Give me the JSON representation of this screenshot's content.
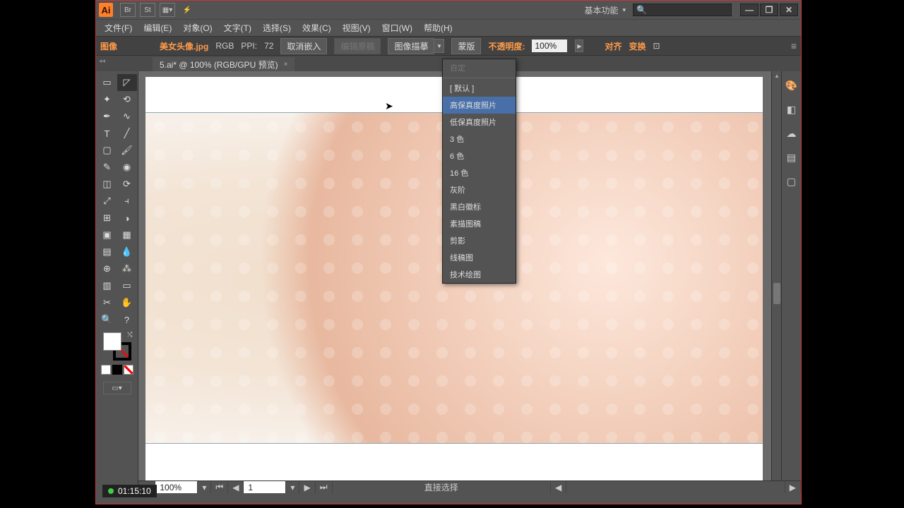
{
  "app": {
    "logo_text": "Ai"
  },
  "titlebar_icons": {
    "br": "Br",
    "st": "St"
  },
  "workspace_label": "基本功能",
  "search_placeholder": "🔍",
  "window_controls": {
    "min": "—",
    "max": "❐",
    "close": "✕"
  },
  "menubar": [
    "文件(F)",
    "编辑(E)",
    "对象(O)",
    "文字(T)",
    "选择(S)",
    "效果(C)",
    "视图(V)",
    "窗口(W)",
    "帮助(H)"
  ],
  "ctrlbar": {
    "label_image": "图像",
    "filename": "美女头像.jpg",
    "colormode": "RGB",
    "ppi_label": "PPI:",
    "ppi_value": "72",
    "btn_unembed": "取消嵌入",
    "btn_editoriginal": "编辑原稿",
    "btn_imagetrace": "图像描摹",
    "btn_mask": "蒙版",
    "opacity_label": "不透明度:",
    "opacity_value": "100%",
    "btn_align": "对齐",
    "btn_transform": "变换",
    "gear": "≡"
  },
  "doc_tab": {
    "title": "5.ai* @ 100% (RGB/GPU 预览)",
    "close": "×"
  },
  "tracing_presets": {
    "header_disabled": "自定",
    "items": [
      "[ 默认 ]",
      "高保真度照片",
      "低保真度照片",
      "3 色",
      "6 色",
      "16 色",
      "灰阶",
      "黑白徽标",
      "素描图稿",
      "剪影",
      "线稿图",
      "技术绘图"
    ],
    "highlighted_index": 1
  },
  "tools": [
    [
      "selection",
      "direct-selection"
    ],
    [
      "magic-wand",
      "lasso"
    ],
    [
      "pen",
      "curvature"
    ],
    [
      "type",
      "line"
    ],
    [
      "rectangle",
      "paintbrush"
    ],
    [
      "pencil",
      "blob-brush"
    ],
    [
      "eraser",
      "rotate"
    ],
    [
      "scale",
      "width"
    ],
    [
      "free-transform",
      "shape-builder"
    ],
    [
      "perspective",
      "mesh"
    ],
    [
      "gradient",
      "eyedropper"
    ],
    [
      "blend",
      "symbol-sprayer"
    ],
    [
      "column-graph",
      "artboard"
    ],
    [
      "slice",
      "hand"
    ],
    [
      "zoom",
      "help"
    ]
  ],
  "statusbar": {
    "zoom": "100%",
    "page": "1",
    "tool_label": "直接选择"
  },
  "right_panel_icons": [
    "color",
    "swatch",
    "cc",
    "layers",
    "artboards"
  ],
  "timecode": "01:15:10"
}
